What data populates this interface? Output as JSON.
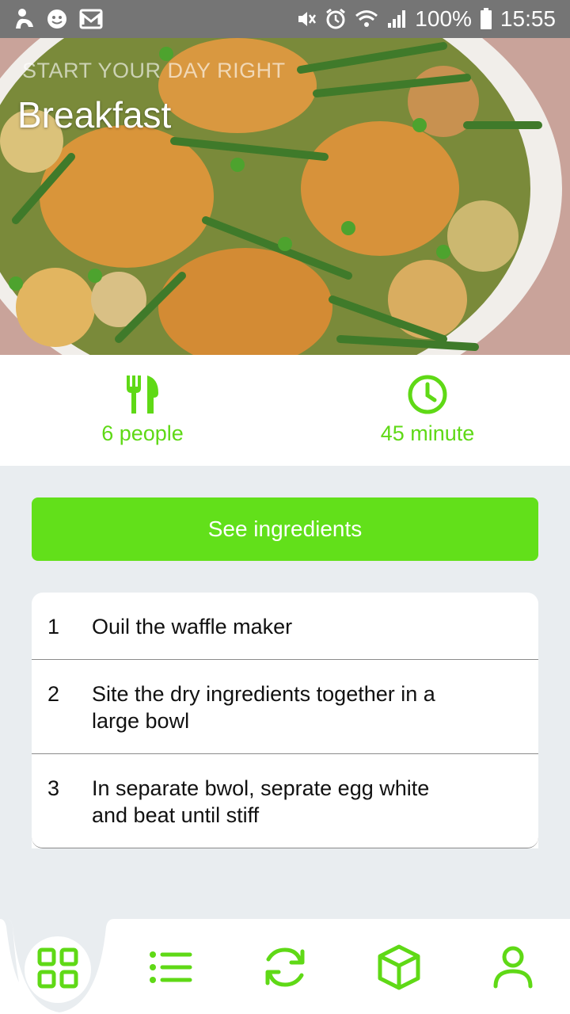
{
  "status_bar": {
    "battery": "100%",
    "time": "15:55",
    "icons": [
      "app-icon",
      "face-icon",
      "mail-icon",
      "mute-icon",
      "alarm-icon",
      "wifi-icon",
      "signal-icon",
      "battery-icon"
    ]
  },
  "hero": {
    "subtitle": "START YOUR DAY RIGHT",
    "title": "Breakfast"
  },
  "info": {
    "people": "6 people",
    "time": "45 minute",
    "icons": [
      "utensils-icon",
      "clock-icon"
    ]
  },
  "button": {
    "label": "See ingredients"
  },
  "steps": [
    {
      "num": "1",
      "text": "Ouil the waffle maker"
    },
    {
      "num": "2",
      "text": "Site the dry ingredients together in a large bowl"
    },
    {
      "num": "3",
      "text": "In separate bwol, seprate egg white and beat until stiff"
    }
  ],
  "nav": {
    "items": [
      "grid-icon",
      "list-icon",
      "refresh-icon",
      "box-icon",
      "user-icon"
    ],
    "active": "grid-icon"
  },
  "colors": {
    "accent": "#62e01a",
    "accent_text": "#5fd916",
    "background": "#e9edf0",
    "status_bar": "#757575"
  }
}
